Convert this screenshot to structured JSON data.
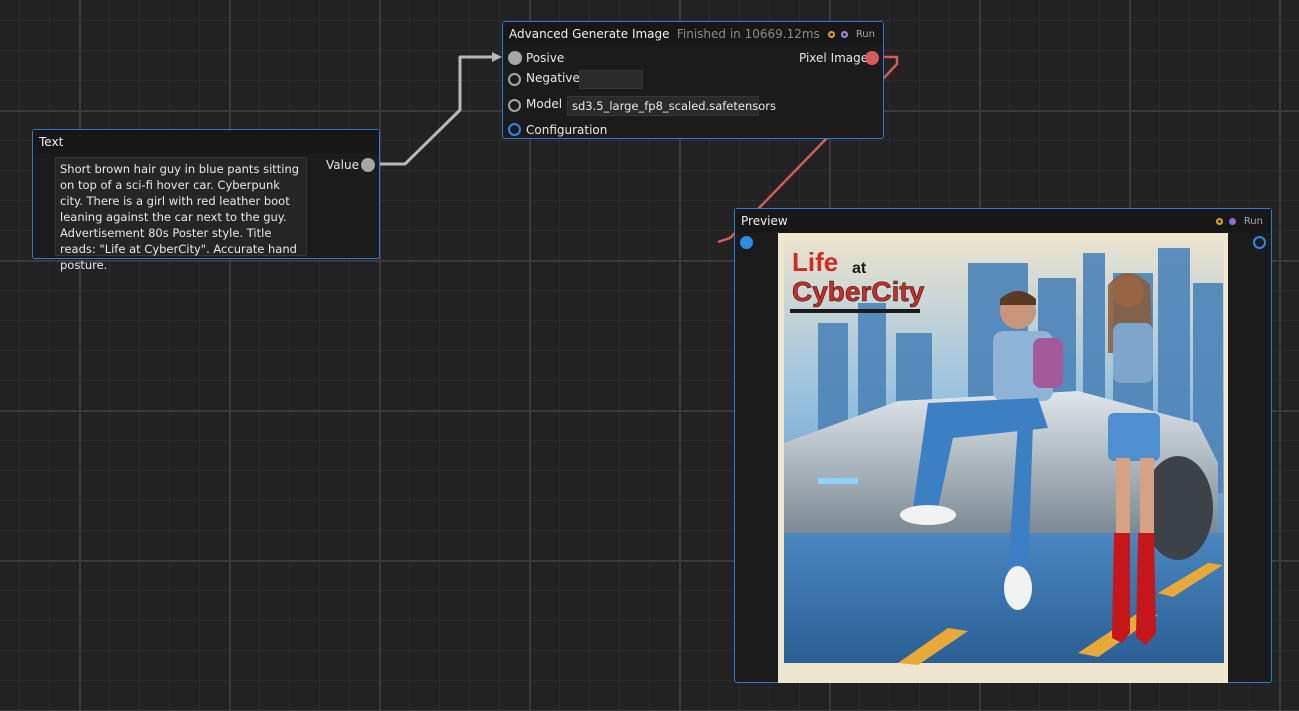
{
  "text_node": {
    "title": "Text",
    "output_label": "Value",
    "content": "Short brown hair guy in blue pants sitting on top of a sci-fi hover car. Cyberpunk city. There is a girl with red leather boot leaning against the car next to the guy. Advertisement 80s Poster style. Title reads: \"Life at CyberCity\". Accurate hand posture."
  },
  "generate_node": {
    "title": "Advanced Generate Image",
    "status": "Finished in 10669.12ms",
    "run_label": "Run",
    "inputs": {
      "positive_label": "Posive",
      "negative_label": "Negative",
      "negative_value": "",
      "model_label": "Model",
      "model_value": "sd3.5_large_fp8_scaled.safetensors",
      "configuration_label": "Configuration"
    },
    "output_label": "Pixel Image"
  },
  "preview_node": {
    "title": "Preview",
    "run_label": "Run",
    "image": {
      "title_line1": "Life",
      "title_at": "at",
      "title_line2": "CyberCity"
    }
  },
  "colors": {
    "accent": "#2b7bd6",
    "wire_gray": "#b8b8b8",
    "wire_red": "#d25c5c",
    "status_orange": "#e3a322",
    "status_purple": "#8e6bd6"
  }
}
